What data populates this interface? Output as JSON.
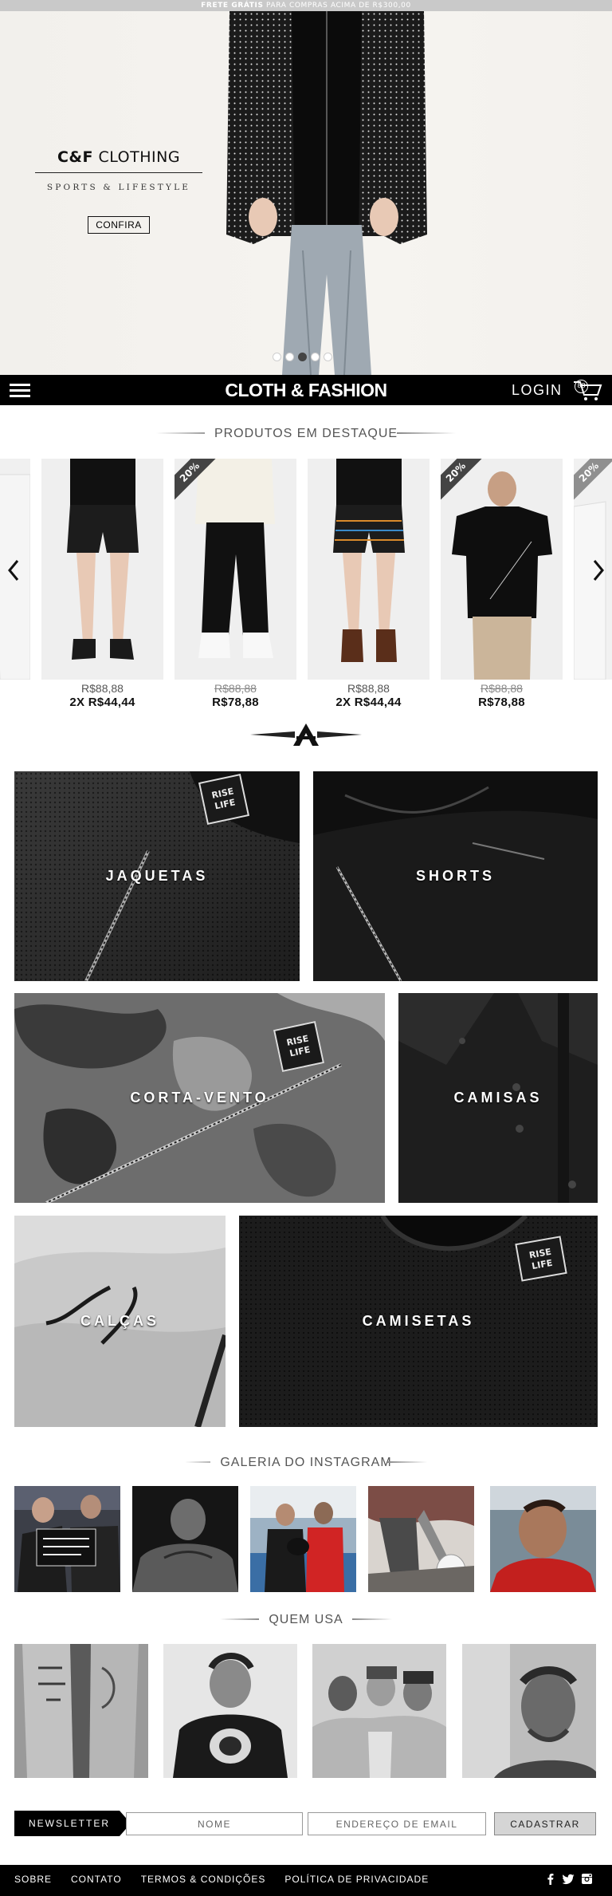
{
  "promo": {
    "bold": "FRETE GRÁTIS",
    "text": "PARA COMPRAS ACIMA DE R$300,00"
  },
  "hero": {
    "title_bold": "C&F",
    "title_rest": "CLOTHING",
    "subtitle": "SPORTS & LIFESTYLE",
    "cta_label": "CONFIRA",
    "slide_count": 5,
    "active_slide": 3
  },
  "navbar": {
    "logo": "CLOTH & FASHION",
    "login_label": "LOGIN",
    "cart_count": "88"
  },
  "featured": {
    "heading": "PRODUTOS EM DESTAQUE",
    "products": [
      {
        "old_price": "R$88,88",
        "price": "2X R$44,44",
        "sale": false,
        "badge": ""
      },
      {
        "old_price": "R$88,88",
        "price": "R$78,88",
        "sale": true,
        "badge": "20%"
      },
      {
        "old_price": "R$88,88",
        "price": "2X R$44,44",
        "sale": false,
        "badge": ""
      },
      {
        "old_price": "R$88,88",
        "price": "R$78,88",
        "sale": true,
        "badge": "20%"
      },
      {
        "old_price": "",
        "price": "",
        "sale": true,
        "badge": "20%"
      }
    ]
  },
  "categories": [
    {
      "label": "JAQUETAS"
    },
    {
      "label": "SHORTS"
    },
    {
      "label": "CORTA-VENTO"
    },
    {
      "label": "CAMISAS"
    },
    {
      "label": "CALÇAS"
    },
    {
      "label": "CAMISETAS"
    }
  ],
  "tag_text": "RISE LIFE",
  "instagram": {
    "heading": "GALERIA DO INSTAGRAM",
    "photo_count": 5
  },
  "quem_usa": {
    "heading": "QUEM USA",
    "photo_count": 4
  },
  "newsletter": {
    "label": "NEWSLETTER",
    "name_placeholder": "NOME",
    "email_placeholder": "ENDEREÇO DE EMAIL",
    "submit_label": "CADASTRAR"
  },
  "footer": {
    "links": [
      "SOBRE",
      "CONTATO",
      "TERMOS & CONDIÇÕES",
      "POLÍTICA DE PRIVACIDADE"
    ],
    "socials": [
      "facebook-icon",
      "twitter-icon",
      "instagram-icon"
    ]
  }
}
